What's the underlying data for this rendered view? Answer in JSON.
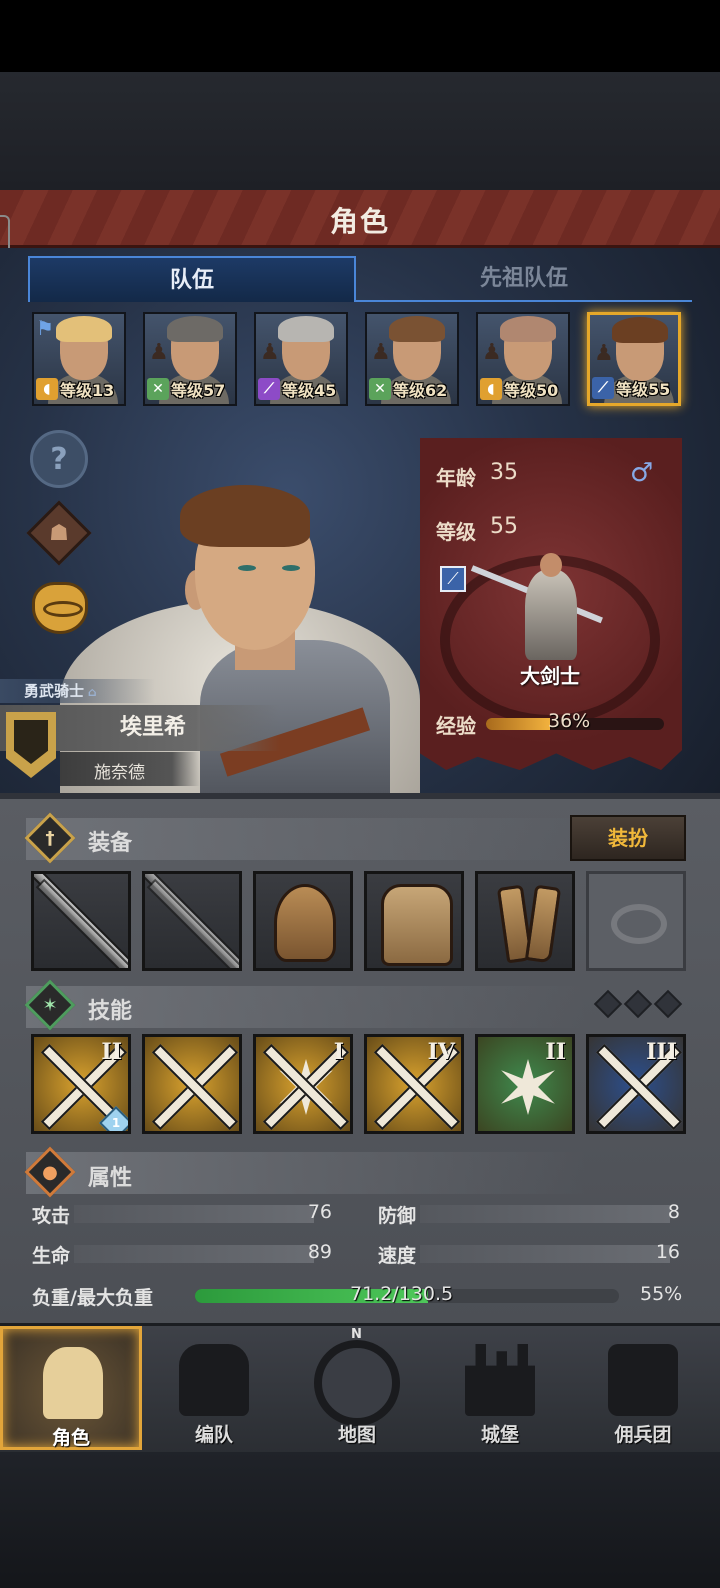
{
  "header": {
    "title": "角色"
  },
  "tabs": [
    {
      "label": "队伍",
      "active": true
    },
    {
      "label": "先祖队伍",
      "active": false
    }
  ],
  "roster": [
    {
      "level_text": "等级13",
      "class_icon": "shield-icon",
      "class_color": "#e0a030",
      "hair_color": "#e3c079",
      "has_flag": true,
      "selected": false
    },
    {
      "level_text": "等级57",
      "class_icon": "crossed-weapons-icon",
      "class_color": "#5ba35b",
      "hair_color": "#6d6a66",
      "has_flag": false,
      "selected": false
    },
    {
      "level_text": "等级45",
      "class_icon": "staff-icon",
      "class_color": "#8d4bc7",
      "hair_color": "#b7b5b1",
      "has_flag": false,
      "selected": false
    },
    {
      "level_text": "等级62",
      "class_icon": "crossed-weapons-icon",
      "class_color": "#5ba35b",
      "hair_color": "#7a5233",
      "has_flag": false,
      "selected": false
    },
    {
      "level_text": "等级50",
      "class_icon": "shield-icon",
      "class_color": "#e0a030",
      "hair_color": "#b08770",
      "has_flag": false,
      "selected": false
    },
    {
      "level_text": "等级55",
      "class_icon": "sword-icon",
      "class_color": "#3b63a8",
      "hair_color": "#6b3f22",
      "has_flag": false,
      "selected": true
    }
  ],
  "hero": {
    "title": "勇武骑士",
    "name": "埃里希",
    "surname": "施奈德",
    "age_label": "年龄",
    "age": "35",
    "level_label": "等级",
    "level": "55",
    "gender_icon": "♂",
    "class_name": "大剑士",
    "exp_label": "经验",
    "exp_text": "36%",
    "exp_fraction": 0.36
  },
  "equipment": {
    "title": "装备",
    "dress_button": "装扮",
    "slots": [
      "greatsword-icon",
      "greatsword-icon",
      "helmet-icon",
      "armor-icon",
      "boots-icon",
      "ring-icon"
    ]
  },
  "skills": {
    "title": "技能",
    "items": [
      {
        "icon": "arrow-strike-icon",
        "rank": "II",
        "color": "#d9a22e",
        "badge": "1"
      },
      {
        "icon": "sword-aura-icon",
        "rank": "",
        "color": "#d9a22e",
        "badge": ""
      },
      {
        "icon": "burst-strike-icon",
        "rank": "I",
        "color": "#d9a22e",
        "badge": ""
      },
      {
        "icon": "crossed-swords-icon",
        "rank": "IV",
        "color": "#d9a22e",
        "badge": ""
      },
      {
        "icon": "starburst-icon",
        "rank": "II",
        "color": "#3f8a4e",
        "badge": ""
      },
      {
        "icon": "crossed-swords-icon",
        "rank": "III",
        "color": "#2c4f8e",
        "badge": ""
      }
    ]
  },
  "attributes": {
    "title": "属性",
    "attack_label": "攻击",
    "attack": "76",
    "defense_label": "防御",
    "defense": "8",
    "hp_label": "生命",
    "hp": "89",
    "speed_label": "速度",
    "speed": "16",
    "load_label": "负重/最大负重",
    "load_text": "71.2/130.5",
    "load_pct": "55%",
    "load_fraction": 0.55
  },
  "nav": [
    {
      "label": "角色",
      "icon": "knight-icon",
      "active": true
    },
    {
      "label": "编队",
      "icon": "helmet-group-icon",
      "active": false
    },
    {
      "label": "地图",
      "icon": "compass-icon",
      "active": false
    },
    {
      "label": "城堡",
      "icon": "castle-icon",
      "active": false
    },
    {
      "label": "佣兵团",
      "icon": "mercenary-icon",
      "active": false
    }
  ],
  "compass_letter": "N"
}
